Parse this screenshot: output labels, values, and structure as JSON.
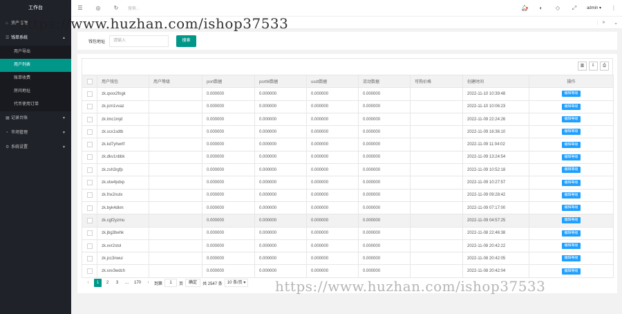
{
  "sidebar": {
    "logo": "工作台",
    "items": [
      {
        "label": "资产管理",
        "icon": "home-icon",
        "expanded": false
      },
      {
        "label": "钱单系统",
        "icon": "list-icon",
        "expanded": true,
        "children": [
          "用户导出",
          "用户列表",
          "账单收费",
          "房间地址",
          "代币使用订单"
        ]
      },
      {
        "label": "记录台账",
        "icon": "grid-icon",
        "expanded": false
      },
      {
        "label": "市场管理",
        "icon": "chart-icon",
        "expanded": false
      },
      {
        "label": "系统设置",
        "icon": "gear-icon",
        "expanded": false
      }
    ],
    "active_child": 1
  },
  "header": {
    "search_placeholder": "搜索...",
    "user": "admin"
  },
  "search": {
    "label": "钱包地址",
    "placeholder": "请输入",
    "button": "搜索"
  },
  "table": {
    "columns": [
      "用户钱包",
      "用户等级",
      "port数据",
      "portM数据",
      "usdt数据",
      "流动数据",
      "可购价格",
      "创建时间",
      "操作"
    ],
    "op_label": "编辑等级",
    "rows": [
      [
        "zk.qxxx2fngk",
        "",
        "0.000000",
        "0.000000",
        "0.000000",
        "0.000000",
        "",
        "2022-11-10 10:39:48"
      ],
      [
        "zk.jcm1vvaz",
        "",
        "0.000000",
        "0.000000",
        "0.000000",
        "0.000000",
        "",
        "2022-11-10 10:06:23"
      ],
      [
        "zk.tmc1mjd",
        "",
        "0.000000",
        "0.000000",
        "0.000000",
        "0.000000",
        "",
        "2022-11-09 22:24:26"
      ],
      [
        "zk.scx1sdtb",
        "",
        "0.000000",
        "0.000000",
        "0.000000",
        "0.000000",
        "",
        "2022-11-09 16:36:10"
      ],
      [
        "zk.kd7yhwrtf",
        "",
        "0.000000",
        "0.000000",
        "0.000000",
        "0.000000",
        "",
        "2022-11-09 11:04:02"
      ],
      [
        "zk.dkv1nbbk",
        "",
        "0.000000",
        "0.000000",
        "0.000000",
        "0.000000",
        "",
        "2022-11-09 13:24:54"
      ],
      [
        "zk.zsh3rgfp",
        "",
        "0.000000",
        "0.000000",
        "0.000000",
        "0.000000",
        "",
        "2022-11-09 10:52:18"
      ],
      [
        "zk.otw4pdxp",
        "",
        "0.000000",
        "0.000000",
        "0.000000",
        "0.000000",
        "",
        "2022-11-09 10:27:57"
      ],
      [
        "zk.fnx2nutx",
        "",
        "0.000000",
        "0.000000",
        "0.000000",
        "0.000000",
        "",
        "2022-11-09 09:28:42"
      ],
      [
        "zk.byk4dkm",
        "",
        "0.000000",
        "0.000000",
        "0.000000",
        "0.000000",
        "",
        "2022-11-09 07:17:00"
      ],
      [
        "zk.cgf2yzmu",
        "",
        "0.000000",
        "0.000000",
        "0.000000",
        "0.000000",
        "",
        "2022-11-09 04:57:25"
      ],
      [
        "zk.jbg3behk",
        "",
        "0.000000",
        "0.000000",
        "0.000000",
        "0.000000",
        "",
        "2022-11-08 22:46:38"
      ],
      [
        "zk.xvr2stol",
        "",
        "0.000000",
        "0.000000",
        "0.000000",
        "0.000000",
        "",
        "2022-11-08 20:42:22"
      ],
      [
        "zk.jcc3nwui",
        "",
        "0.000000",
        "0.000000",
        "0.000000",
        "0.000000",
        "",
        "2022-11-08 20:42:05"
      ],
      [
        "zk.xxv3wdch",
        "",
        "0.000000",
        "0.000000",
        "0.000000",
        "0.000000",
        "",
        "2022-11-08 20:42:04"
      ]
    ],
    "highlight_row": 10
  },
  "pager": {
    "pages": [
      "1",
      "2",
      "3",
      "...",
      "170"
    ],
    "goto_label": "到第",
    "goto_value": "1",
    "page_unit": "页",
    "confirm": "确定",
    "total": "共 2547 条",
    "page_size": "10 条/页"
  },
  "watermark": {
    "text1": "https://www.huzhan.com/ishop37533",
    "text2": "https://www.huzhan.com/ishop37533"
  },
  "colors": {
    "sidebar_bg": "#20222a",
    "accent": "#009688",
    "op_button": "#1e9fff"
  }
}
